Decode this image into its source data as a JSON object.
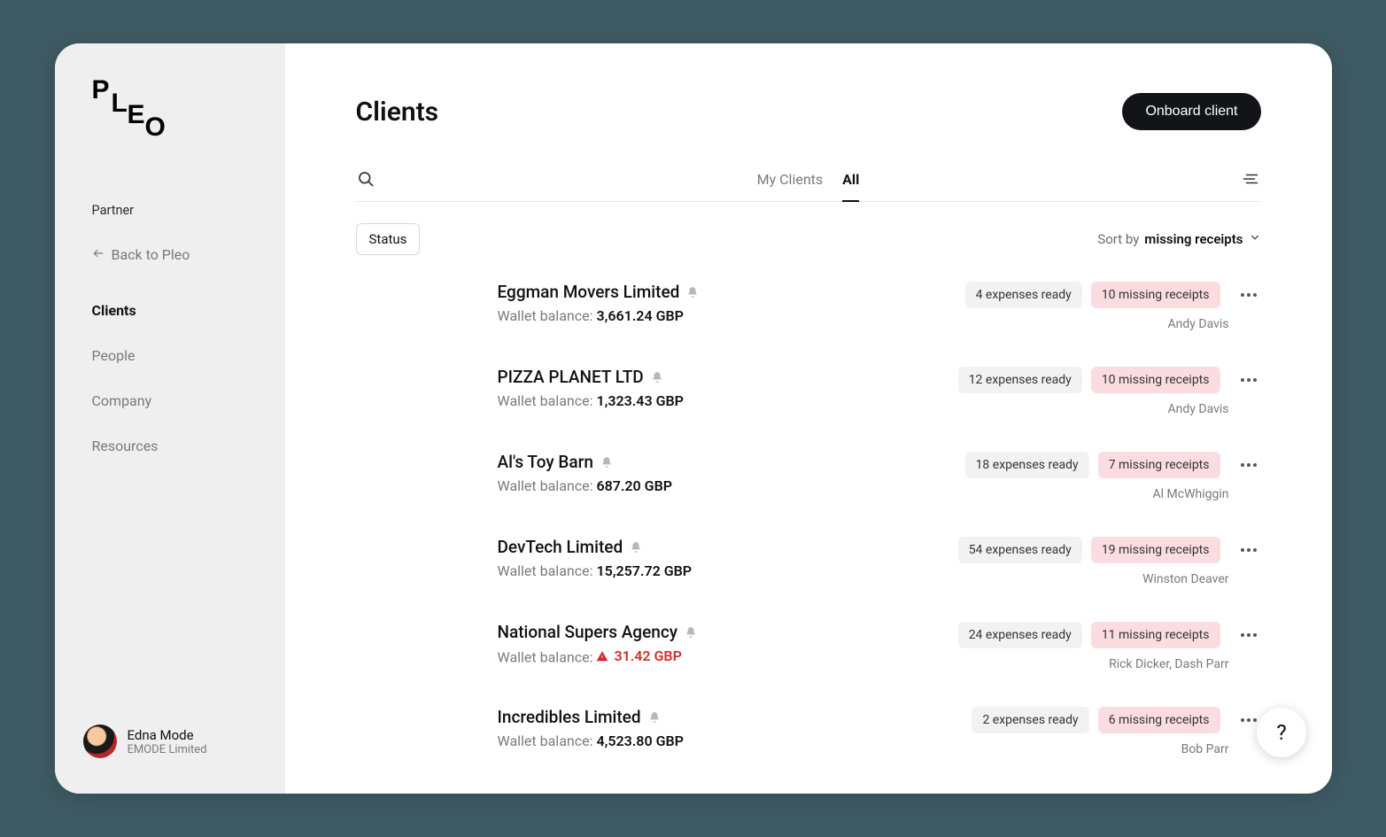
{
  "brand": {
    "partner_label": "Partner"
  },
  "sidebar": {
    "back_label": "Back to Pleo",
    "items": [
      {
        "label": "Clients",
        "active": true
      },
      {
        "label": "People",
        "active": false
      },
      {
        "label": "Company",
        "active": false
      },
      {
        "label": "Resources",
        "active": false
      }
    ]
  },
  "user": {
    "name": "Edna Mode",
    "org": "EMODE Limited"
  },
  "header": {
    "title": "Clients",
    "onboard_button": "Onboard client"
  },
  "tabs": {
    "my_clients": "My Clients",
    "all": "All",
    "active": "all"
  },
  "filters": {
    "status_label": "Status"
  },
  "sort": {
    "prefix": "Sort by",
    "value": "missing receipts"
  },
  "wallet_label": "Wallet balance:",
  "colors": {
    "danger": "#d42c2c",
    "pink_bg": "#fbdde1",
    "gray_bg": "#f2f2f2"
  },
  "clients": [
    {
      "name": "Eggman Movers Limited",
      "balance": "3,661.24 GBP",
      "low": false,
      "expenses": "4 expenses ready",
      "receipts": "10 missing receipts",
      "assignee": "Andy Davis"
    },
    {
      "name": "PIZZA PLANET LTD",
      "balance": "1,323.43 GBP",
      "low": false,
      "expenses": "12 expenses ready",
      "receipts": "10 missing receipts",
      "assignee": "Andy Davis"
    },
    {
      "name": "Al's Toy Barn",
      "balance": "687.20 GBP",
      "low": false,
      "expenses": "18 expenses ready",
      "receipts": "7 missing receipts",
      "assignee": "Al McWhiggin"
    },
    {
      "name": "DevTech Limited",
      "balance": "15,257.72 GBP",
      "low": false,
      "expenses": "54 expenses ready",
      "receipts": "19 missing receipts",
      "assignee": "Winston Deaver"
    },
    {
      "name": "National Supers Agency",
      "balance": "31.42 GBP",
      "low": true,
      "expenses": "24 expenses ready",
      "receipts": "11 missing receipts",
      "assignee": "Rick Dicker, Dash Parr"
    },
    {
      "name": "Incredibles Limited",
      "balance": "4,523.80 GBP",
      "low": false,
      "expenses": "2 expenses ready",
      "receipts": "6 missing receipts",
      "assignee": "Bob Parr"
    }
  ],
  "help": {
    "symbol": "?"
  }
}
